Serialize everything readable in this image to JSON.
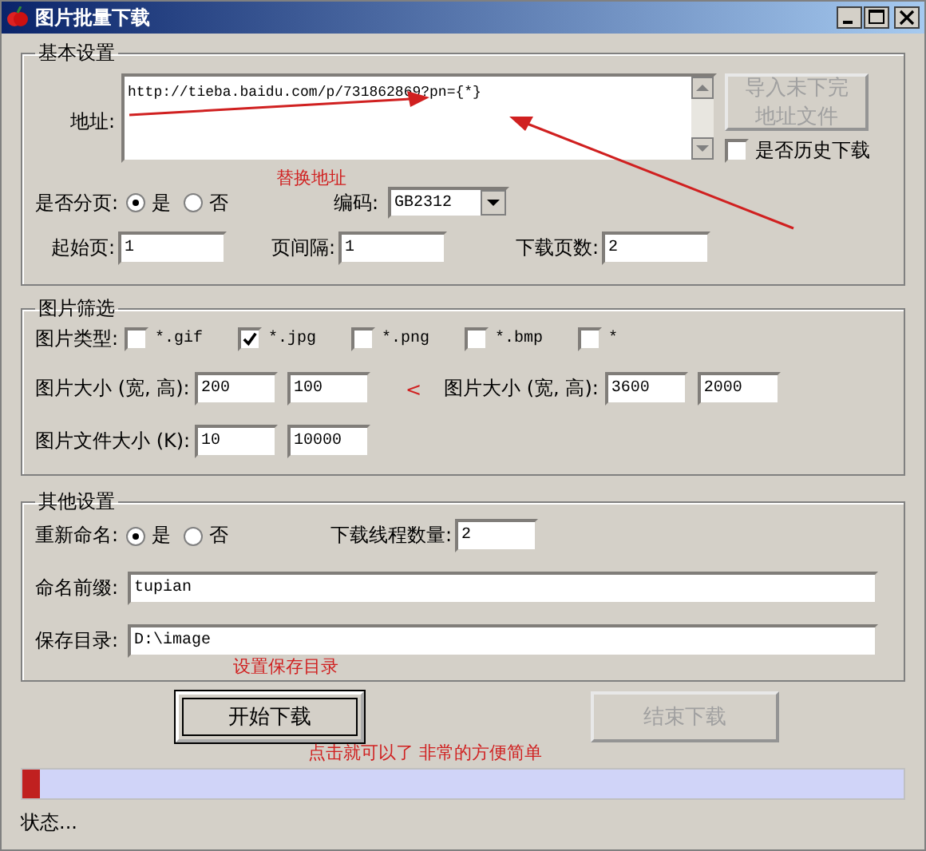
{
  "window": {
    "title": "图片批量下载"
  },
  "basic": {
    "title": "基本设置",
    "address_label": "地址:",
    "address_value": "http://tieba.baidu.com/p/731862869?pn={*}",
    "import_button": {
      "lines": [
        "导入未下完",
        "地址文件"
      ],
      "disabled": true
    },
    "history": {
      "label": "是否历史下载",
      "checked": false
    },
    "paging": {
      "label": "是否分页:",
      "options": [
        {
          "label": "是",
          "selected": true
        },
        {
          "label": "否",
          "selected": false
        }
      ]
    },
    "encoding": {
      "label": "编码:",
      "value": "GB2312"
    },
    "fields": [
      {
        "label": "起始页:",
        "value": "1"
      },
      {
        "label": "页间隔:",
        "value": "1"
      },
      {
        "label": "下载页数:",
        "value": "2"
      }
    ]
  },
  "filter": {
    "title": "图片筛选",
    "type_label": "图片类型:",
    "types": [
      {
        "label": "*.gif",
        "checked": false
      },
      {
        "label": "*.jpg",
        "checked": true
      },
      {
        "label": "*.png",
        "checked": false
      },
      {
        "label": "*.bmp",
        "checked": false
      },
      {
        "label": "*",
        "checked": false
      }
    ],
    "min_label": "图片大小 (宽, 高):",
    "min_values": [
      "200",
      "100"
    ],
    "less_than": "<",
    "max_label": "图片大小 (宽, 高):",
    "max_values": [
      "3600",
      "2000"
    ],
    "file_label": "图片文件大小 (K):",
    "file_values": [
      "10",
      "10000"
    ]
  },
  "other": {
    "title": "其他设置",
    "rename": {
      "label": "重新命名:",
      "options": [
        {
          "label": "是",
          "selected": true
        },
        {
          "label": "否",
          "selected": false
        }
      ]
    },
    "threads": {
      "label": "下载线程数量:",
      "value": "2"
    },
    "prefix": {
      "label": "命名前缀:",
      "value": "tupian"
    },
    "directory": {
      "label": "保存目录:",
      "value": "D:\\image"
    }
  },
  "buttons": [
    {
      "label": "开始下载",
      "disabled": false
    },
    {
      "label": "结束下载",
      "disabled": true
    }
  ],
  "progress": {
    "level": 0.02
  },
  "status": "状态...",
  "annotations": [
    {
      "text": "替换地址"
    },
    {
      "text": "设置保存目录"
    },
    {
      "text": "点击就可以了  非常的方便简单"
    }
  ]
}
